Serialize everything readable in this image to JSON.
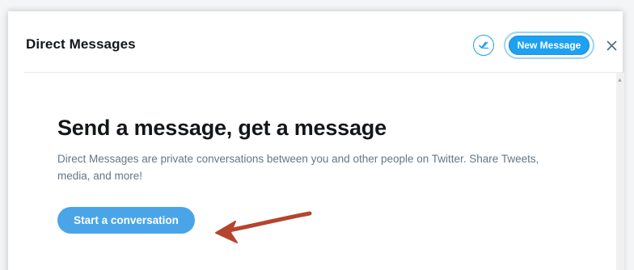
{
  "header": {
    "title": "Direct Messages",
    "new_message_label": "New Message"
  },
  "empty_state": {
    "headline": "Send a message, get a message",
    "description": "Direct Messages are private conversations between you and other people on Twitter. Share Tweets, media, and more!",
    "cta_label": "Start a conversation"
  },
  "icons": {
    "mark_read": "double-check-icon",
    "close": "close-icon",
    "annotation": "red-arrow-icon"
  },
  "colors": {
    "brand_blue": "#1da1f2",
    "cta_blue": "#4aa5e8",
    "annotation_red": "#b5452e",
    "text_primary": "#14171a",
    "text_secondary": "#657786"
  }
}
